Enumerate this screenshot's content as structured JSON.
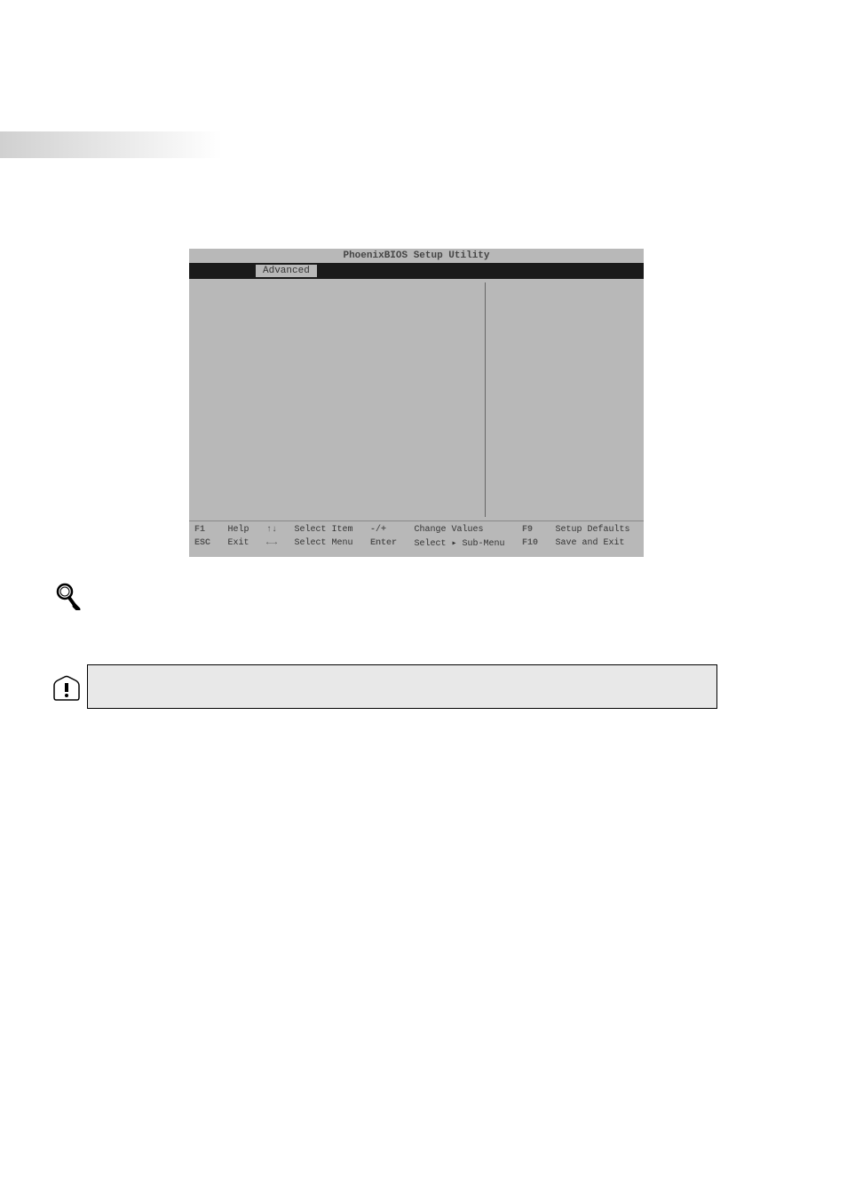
{
  "bios": {
    "title": "PhoenixBIOS Setup Utility",
    "tab": "Advanced",
    "footer": {
      "f1_key": "F1",
      "f1_action": "Help",
      "updown_key": "↑↓",
      "updown_action": "Select Item",
      "plusminus_key": "-/+",
      "plusminus_action": "Change Values",
      "f9_key": "F9",
      "f9_action": "Setup Defaults",
      "esc_key": "ESC",
      "esc_action": "Exit",
      "leftright_key": "←→",
      "leftright_action": "Select Menu",
      "enter_key": "Enter",
      "enter_action": "Select ▸ Sub-Menu",
      "f10_key": "F10",
      "f10_action": "Save and Exit"
    }
  },
  "icons": {
    "magnifier": "magnifier-icon",
    "caution": "caution-icon"
  }
}
